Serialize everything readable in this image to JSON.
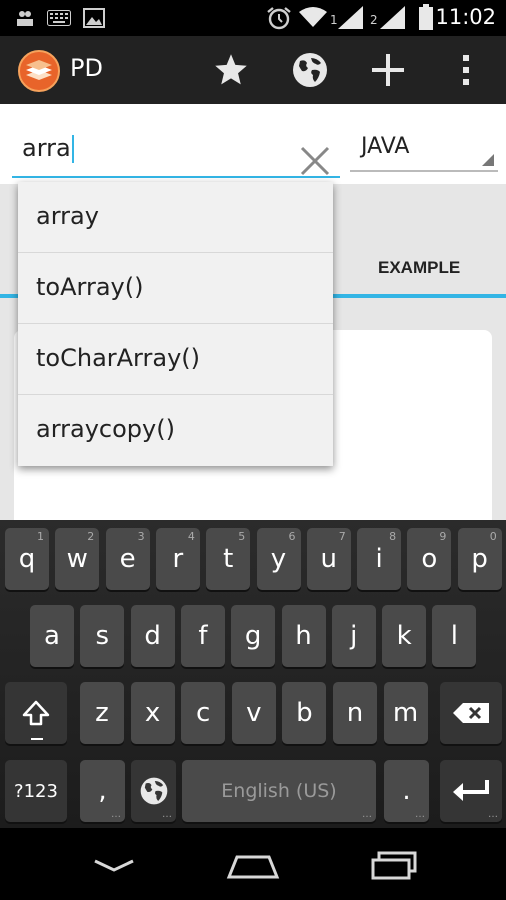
{
  "status_bar": {
    "time": "11:02",
    "sim1_label": "1",
    "sim2_label": "2"
  },
  "action_bar": {
    "app_title": "PD",
    "icons": [
      "app-logo-icon",
      "star-icon",
      "globe-icon",
      "plus-icon",
      "overflow-menu-icon"
    ]
  },
  "search": {
    "value": "arra",
    "clear_icon": "close-icon"
  },
  "language": {
    "selected": "JAVA"
  },
  "tabs": {
    "example_label": "EXAMPLE"
  },
  "suggestions": [
    "array",
    "toArray()",
    "toCharArray()",
    "arraycopy()"
  ],
  "keyboard": {
    "row1": [
      {
        "key": "q",
        "hint": "1"
      },
      {
        "key": "w",
        "hint": "2"
      },
      {
        "key": "e",
        "hint": "3"
      },
      {
        "key": "r",
        "hint": "4"
      },
      {
        "key": "t",
        "hint": "5"
      },
      {
        "key": "y",
        "hint": "6"
      },
      {
        "key": "u",
        "hint": "7"
      },
      {
        "key": "i",
        "hint": "8"
      },
      {
        "key": "o",
        "hint": "9"
      },
      {
        "key": "p",
        "hint": "0"
      }
    ],
    "row2": [
      "a",
      "s",
      "d",
      "f",
      "g",
      "h",
      "j",
      "k",
      "l"
    ],
    "row3": [
      "z",
      "x",
      "c",
      "v",
      "b",
      "n",
      "m"
    ],
    "symbols_label": "?123",
    "comma_label": ",",
    "space_label": "English (US)",
    "period_label": "."
  },
  "colors": {
    "accent": "#33b5e5",
    "action_bar": "#222222",
    "key": "#4a4a4a"
  }
}
